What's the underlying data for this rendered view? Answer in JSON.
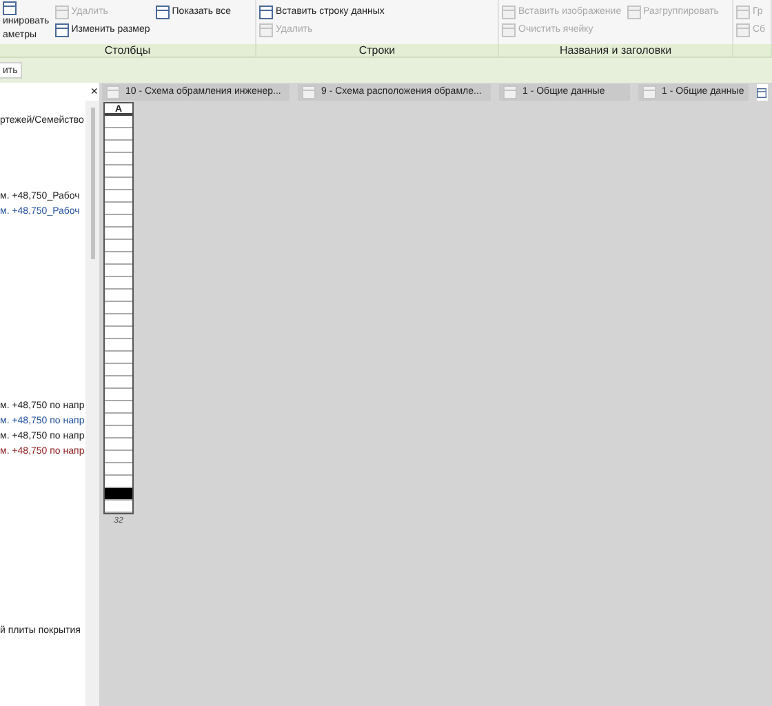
{
  "ribbon": {
    "panels": [
      {
        "label": "Столбцы",
        "columns": [
          [
            {
              "kind": "large",
              "lines": [
                "инировать",
                "аметры"
              ],
              "disabled": false
            }
          ],
          [
            {
              "kind": "small",
              "text": "Удалить",
              "disabled": true
            },
            {
              "kind": "small",
              "text": "Изменить размер",
              "disabled": false
            }
          ],
          [
            {
              "kind": "small",
              "text": "Показать  все",
              "disabled": false
            }
          ]
        ]
      },
      {
        "label": "Строки",
        "columns": [
          [
            {
              "kind": "small",
              "text": "Вставить  строку данных",
              "disabled": false
            },
            {
              "kind": "small",
              "text": "Удалить",
              "disabled": true
            }
          ]
        ]
      },
      {
        "label": "Названия и заголовки",
        "columns": [
          [
            {
              "kind": "small",
              "text": "Вставить  изображение",
              "disabled": true
            },
            {
              "kind": "small",
              "text": "Очистить  ячейку",
              "disabled": true
            }
          ],
          [
            {
              "kind": "small",
              "text": "Разгруппировать",
              "disabled": true
            }
          ]
        ]
      },
      {
        "columns": [
          [
            {
              "kind": "small",
              "text": "Гр",
              "disabled": true
            },
            {
              "kind": "small",
              "text": "Сб",
              "disabled": true
            }
          ]
        ]
      }
    ]
  },
  "options_bar": {
    "button": "ить"
  },
  "tabs": [
    {
      "label": "10 - Схема обрамления инженер...",
      "selected": false
    },
    {
      "label": "9 - Схема расположения обрамле...",
      "selected": false
    },
    {
      "label": "1 - Общие данные",
      "selected": false
    },
    {
      "label": "1 - Общие данные",
      "selected": false
    },
    {
      "selected": true
    }
  ],
  "tabs_close": "×",
  "browser": {
    "items": [
      {
        "text": "ртежей/Семейство",
        "color": "#222222"
      },
      {
        "text": "м. +48,750_Рабоч",
        "color": "#222222"
      },
      {
        "text": "м. +48,750_Рабоч",
        "color": "#1f4e9c"
      },
      {
        "text": "м. +48,750 по напр",
        "color": "#222222"
      },
      {
        "text": "м. +48,750 по напр",
        "color": "#1f4e9c"
      },
      {
        "text": "м. +48,750 по напр",
        "color": "#222222"
      },
      {
        "text": "м. +48,750 по напр",
        "color": "#8b1a1a"
      },
      {
        "text": "й плиты покрытия",
        "color": "#222222"
      }
    ]
  },
  "schedule": {
    "header": "A",
    "footer": "32",
    "rows": [
      {
        "selected": false
      },
      {
        "selected": false
      },
      {
        "selected": false
      },
      {
        "selected": false
      },
      {
        "selected": false
      },
      {
        "selected": false
      },
      {
        "selected": false
      },
      {
        "selected": false
      },
      {
        "selected": false
      },
      {
        "selected": false
      },
      {
        "selected": false
      },
      {
        "selected": false
      },
      {
        "selected": false
      },
      {
        "selected": false
      },
      {
        "selected": false
      },
      {
        "selected": false
      },
      {
        "selected": false
      },
      {
        "selected": false
      },
      {
        "selected": false
      },
      {
        "selected": false
      },
      {
        "selected": false
      },
      {
        "selected": false
      },
      {
        "selected": false
      },
      {
        "selected": false
      },
      {
        "selected": false
      },
      {
        "selected": false
      },
      {
        "selected": false
      },
      {
        "selected": false
      },
      {
        "selected": false
      },
      {
        "selected": false
      },
      {
        "selected": true
      },
      {
        "selected": false
      }
    ]
  }
}
